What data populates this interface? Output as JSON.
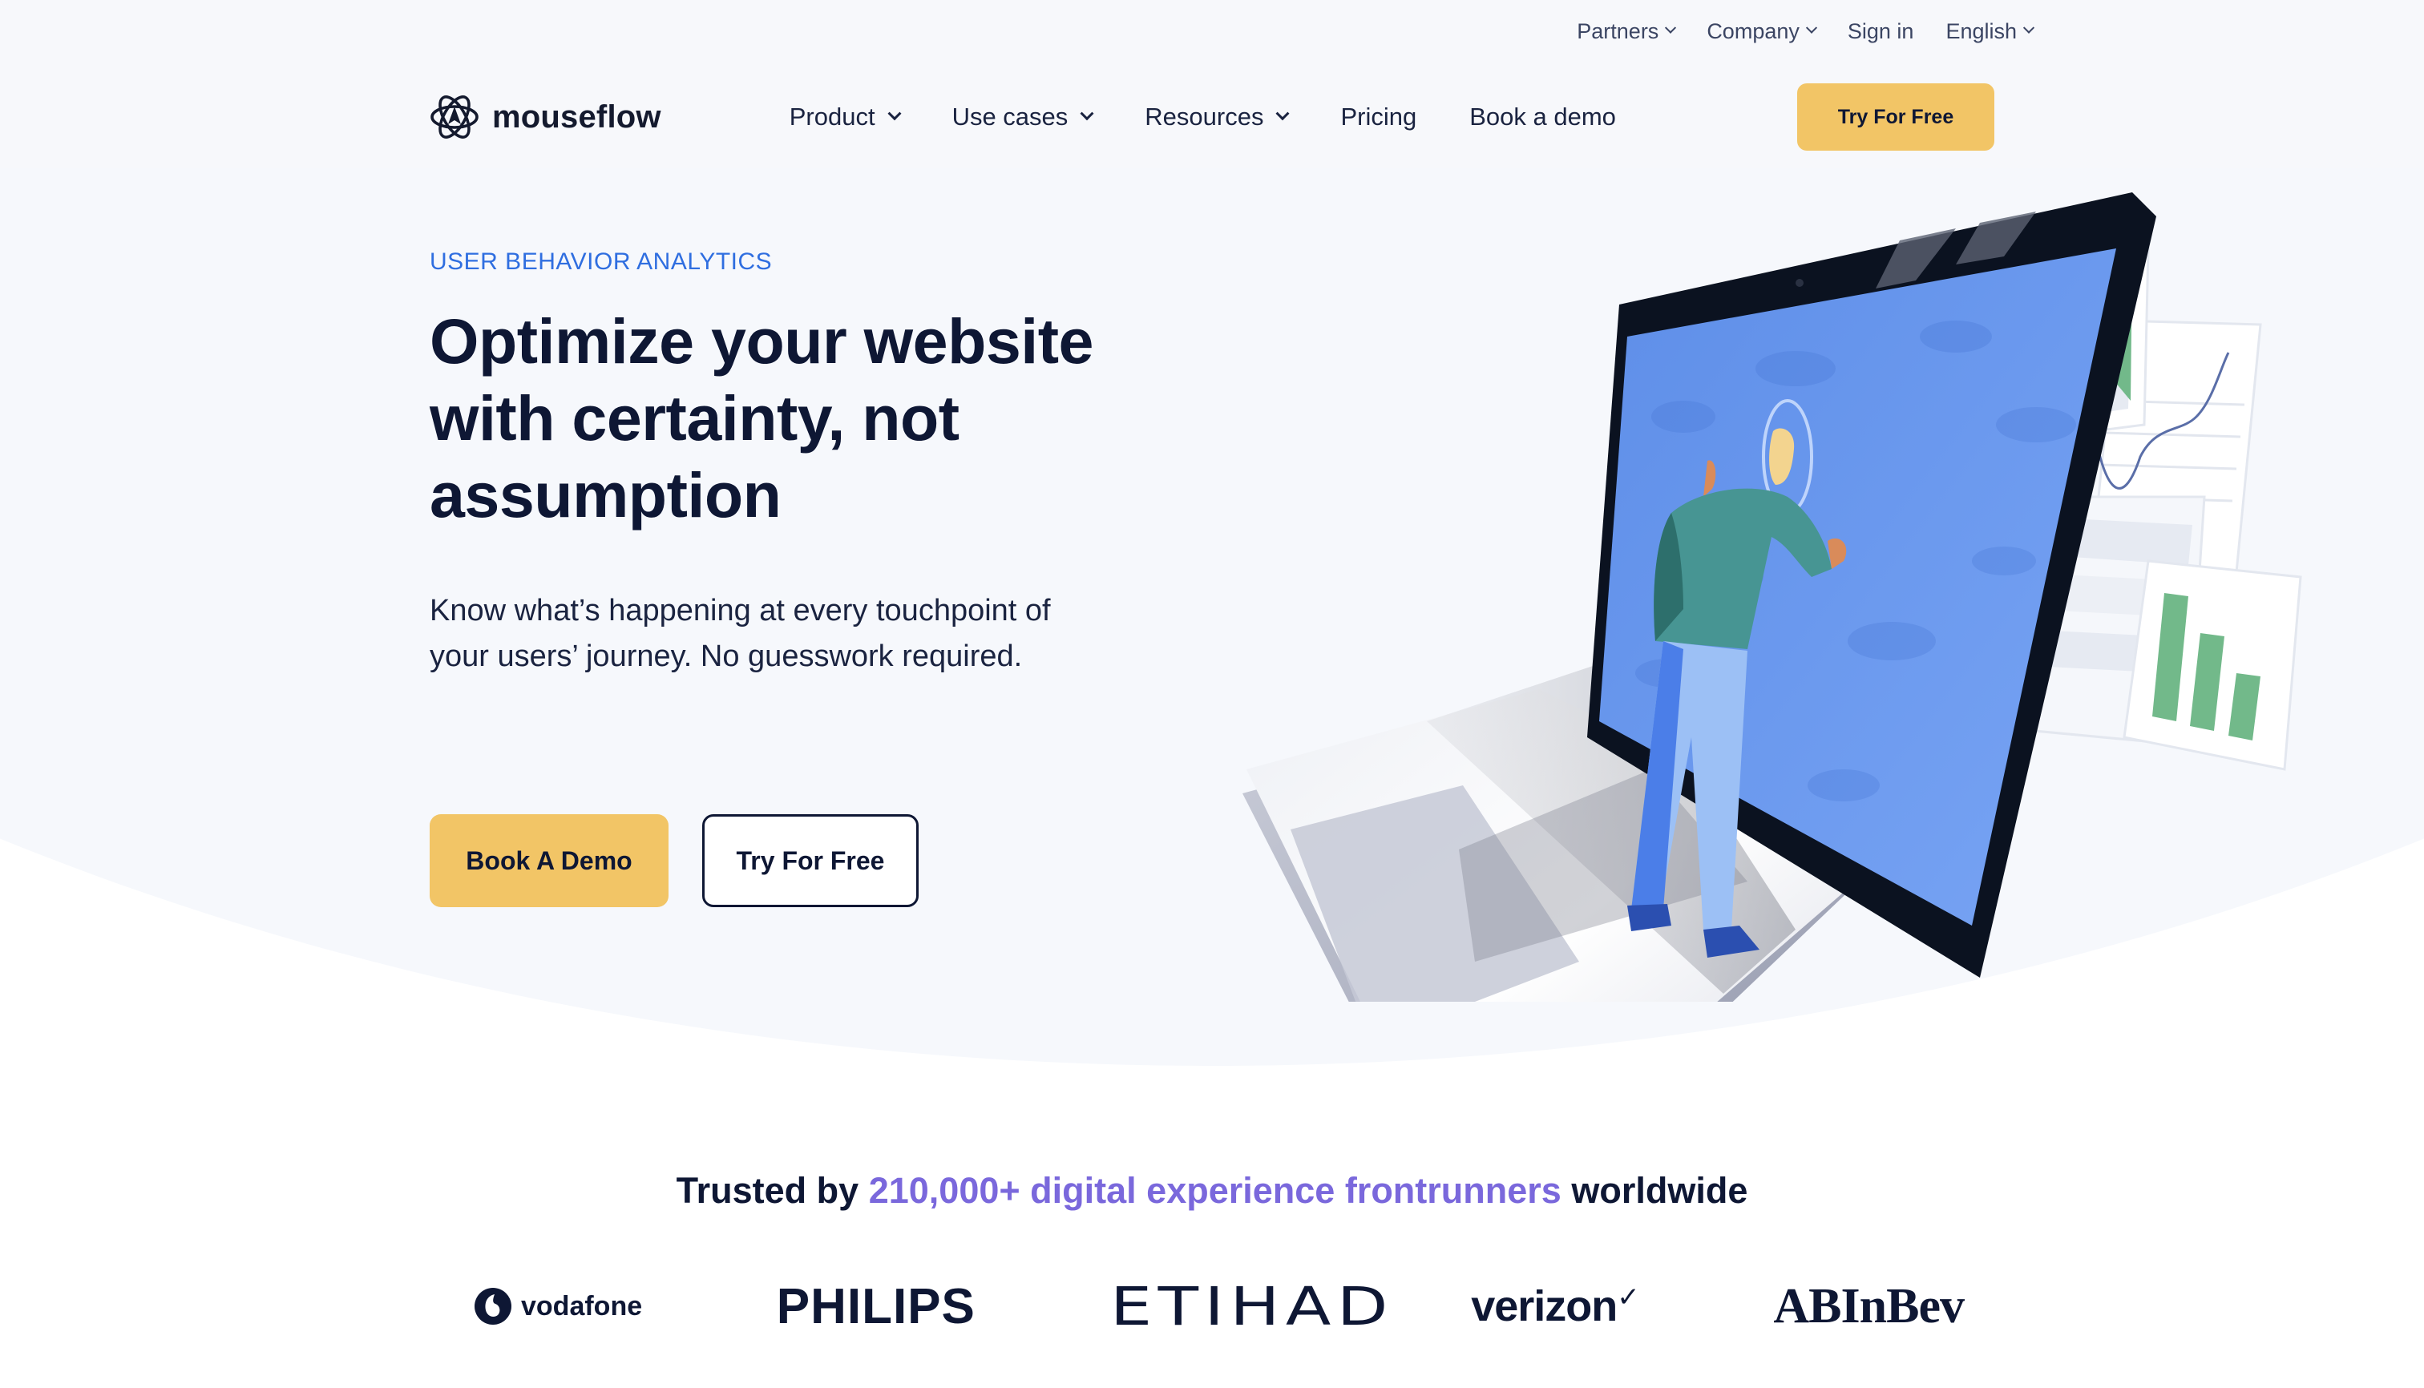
{
  "topbar": {
    "items": [
      {
        "label": "Partners",
        "dropdown": true
      },
      {
        "label": "Company",
        "dropdown": true
      },
      {
        "label": "Sign in",
        "dropdown": false
      },
      {
        "label": "English",
        "dropdown": true
      }
    ]
  },
  "brand": {
    "name": "mouseflow",
    "logo_icon": "atom-cursor-icon"
  },
  "nav": {
    "items": [
      {
        "label": "Product",
        "dropdown": true
      },
      {
        "label": "Use cases",
        "dropdown": true
      },
      {
        "label": "Resources",
        "dropdown": true
      },
      {
        "label": "Pricing",
        "dropdown": false
      },
      {
        "label": "Book a demo",
        "dropdown": false
      }
    ],
    "cta_label": "Try For Free"
  },
  "hero": {
    "eyebrow": "USER BEHAVIOR ANALYTICS",
    "headline_lines": [
      "Optimize your website",
      "with certainty, not",
      "assumption"
    ],
    "subheading_lines": [
      "Know what’s happening at every touchpoint of",
      "your users’ journey. No guesswork required."
    ],
    "primary_cta": "Book A Demo",
    "secondary_cta": "Try For Free",
    "illustration": "person-looking-into-laptop-with-analytics-charts"
  },
  "trusted": {
    "prefix": "Trusted by",
    "highlight": "210,000+ digital experience frontrunners",
    "suffix": "worldwide"
  },
  "customer_logos": [
    "vodafone",
    "PHILIPS",
    "ETIHAD",
    "verizon",
    "ABInBev"
  ],
  "colors": {
    "accent_yellow": "#f2c566",
    "eyebrow_blue": "#2f6ee0",
    "highlight_purple": "#7a68dc",
    "text_navy": "#0e1734",
    "chart_green": "#72b98a",
    "screen_blue": "#6a9af0"
  }
}
